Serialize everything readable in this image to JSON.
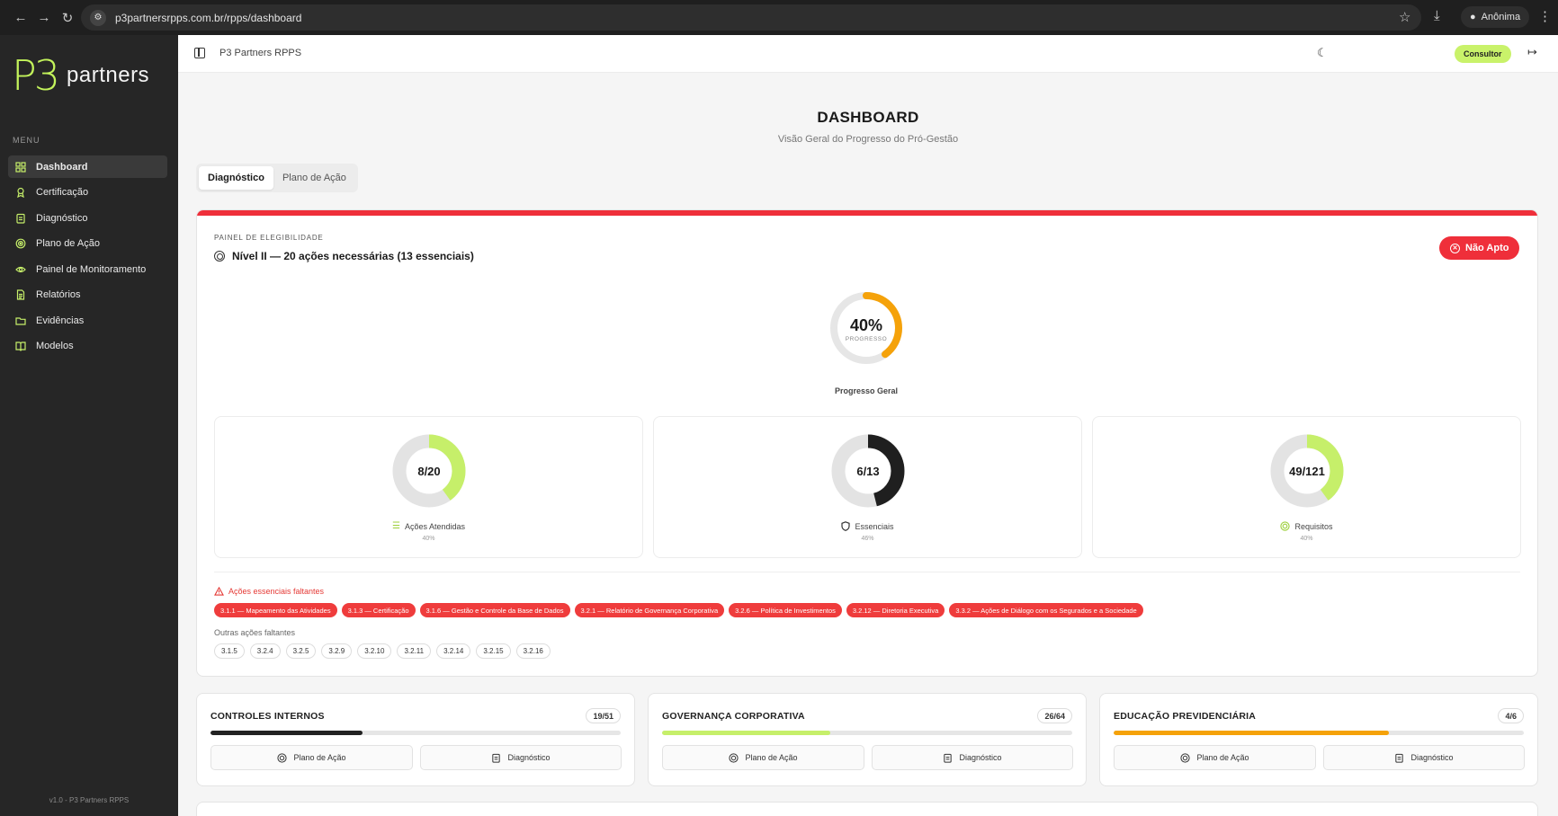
{
  "browser": {
    "url": "p3partnersrpps.com.br/rpps/dashboard",
    "profile_label": "Anônima"
  },
  "sidebar": {
    "logo_mark": "P3",
    "logo_text": "partners",
    "menu_title": "MENU",
    "items": [
      {
        "label": "Dashboard",
        "icon": "grid-icon"
      },
      {
        "label": "Certificação",
        "icon": "award-icon"
      },
      {
        "label": "Diagnóstico",
        "icon": "clipboard-icon"
      },
      {
        "label": "Plano de Ação",
        "icon": "target-icon"
      },
      {
        "label": "Painel de Monitoramento",
        "icon": "eye-icon"
      },
      {
        "label": "Relatórios",
        "icon": "file-icon"
      },
      {
        "label": "Evidências",
        "icon": "folder-icon"
      },
      {
        "label": "Modelos",
        "icon": "book-icon"
      }
    ],
    "version": "v1.0 - P3 Partners RPPS"
  },
  "topbar": {
    "app_title": "P3 Partners RPPS",
    "role_badge": "Consultor"
  },
  "header": {
    "title": "DASHBOARD",
    "subtitle": "Visão Geral do Progresso do Pró-Gestão"
  },
  "tabs": [
    {
      "label": "Diagnóstico",
      "active": true
    },
    {
      "label": "Plano de Ação",
      "active": false
    }
  ],
  "panel": {
    "kicker": "PAINEL DE ELEGIBILIDADE",
    "heading": "Nível II — 20 ações necessárias (13 essenciais)",
    "status": "Não Apto",
    "status_color": "#ef2f3a",
    "overall": {
      "value_text": "40%",
      "caption": "PROGRESSO",
      "label": "Progresso Geral",
      "fraction": 0.4,
      "color": "#f5a20a"
    },
    "stats": [
      {
        "value_text": "8/20",
        "label": "Ações Atendidas",
        "pct": "40%",
        "fraction": 0.4,
        "color": "#c6ef6a",
        "icon": "list-check-icon"
      },
      {
        "value_text": "6/13",
        "label": "Essenciais",
        "pct": "46%",
        "fraction": 0.46,
        "color": "#1f1f1f",
        "icon": "shield-icon"
      },
      {
        "value_text": "49/121",
        "label": "Requisitos",
        "pct": "40%",
        "fraction": 0.4,
        "color": "#c6ef6a",
        "icon": "target-icon"
      }
    ],
    "missing_title": "Ações essenciais faltantes",
    "missing_essential": [
      "3.1.1 — Mapeamento das Atividades",
      "3.1.3 — Certificação",
      "3.1.6 — Gestão e Controle da Base de Dados",
      "3.2.1 — Relatório de Governança Corporativa",
      "3.2.6 — Política de Investimentos",
      "3.2.12 — Diretoria Executiva",
      "3.3.2 — Ações de Diálogo com os Segurados e a Sociedade"
    ],
    "other_title": "Outras ações faltantes",
    "other_missing": [
      "3.1.5",
      "3.2.4",
      "3.2.5",
      "3.2.9",
      "3.2.10",
      "3.2.11",
      "3.2.14",
      "3.2.15",
      "3.2.16"
    ]
  },
  "areas": [
    {
      "title": "CONTROLES INTERNOS",
      "count": "19/51",
      "progress": 0.37,
      "color": "#222222",
      "btn_plan": "Plano de Ação",
      "btn_diag": "Diagnóstico"
    },
    {
      "title": "GOVERNANÇA CORPORATIVA",
      "count": "26/64",
      "progress": 0.41,
      "color": "#c6ef6a",
      "btn_plan": "Plano de Ação",
      "btn_diag": "Diagnóstico"
    },
    {
      "title": "EDUCAÇÃO PREVIDENCIÁRIA",
      "count": "4/6",
      "progress": 0.67,
      "color": "#f5a20a",
      "btn_plan": "Plano de Ação",
      "btn_diag": "Diagnóstico"
    }
  ]
}
